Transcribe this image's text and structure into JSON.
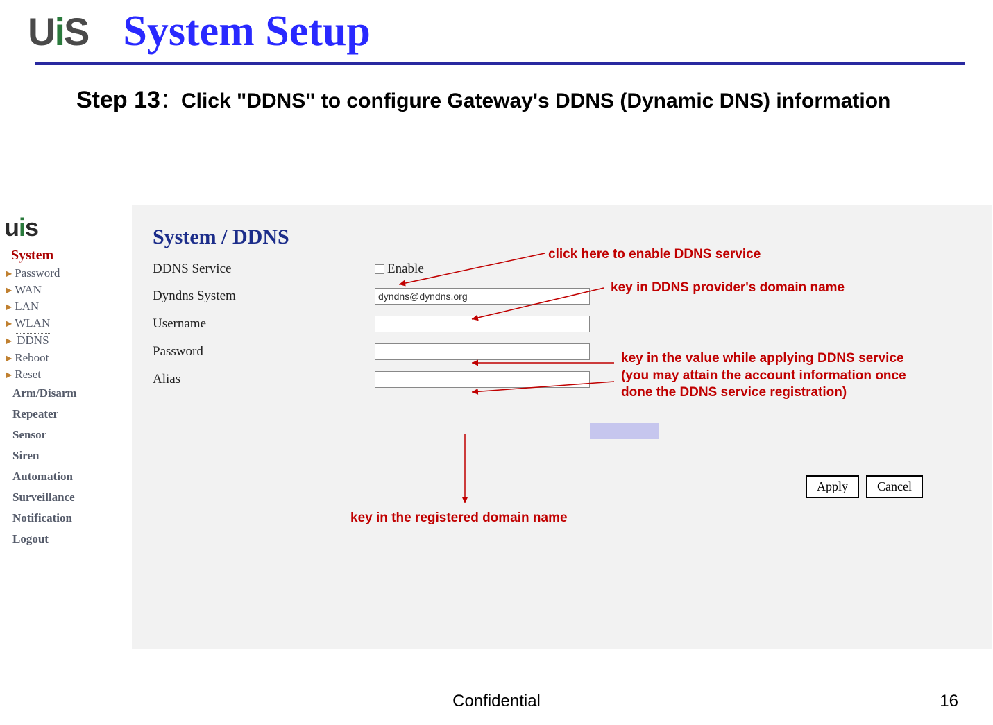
{
  "header": {
    "logo_text": "UiS",
    "title": "System Setup"
  },
  "step": {
    "label": "Step 13",
    "colon": "：",
    "desc": "Click \"DDNS\" to configure Gateway's DDNS (Dynamic DNS) information"
  },
  "inner": {
    "logo": "uis",
    "nav_heading": "System",
    "nav_items": [
      "Password",
      "WAN",
      "LAN",
      "WLAN",
      "DDNS",
      "Reboot",
      "Reset"
    ],
    "nav_groups": [
      "Arm/Disarm",
      "Repeater",
      "Sensor",
      "Siren",
      "Automation",
      "Surveillance",
      "Notification",
      "Logout"
    ]
  },
  "panel": {
    "title": "System / DDNS",
    "rows": {
      "ddns_service": "DDNS Service",
      "enable": "Enable",
      "dyndns_system": "Dyndns System",
      "dyndns_value": "dyndns@dyndns.org",
      "username": "Username",
      "password": "Password",
      "alias": "Alias"
    },
    "buttons": {
      "apply": "Apply",
      "cancel": "Cancel"
    }
  },
  "annotations": {
    "a1": "click here to enable DDNS service",
    "a2": "key in DDNS provider's domain name",
    "a3": "key in the value while applying DDNS service (you may attain the account information once done the DDNS service registration)",
    "a4": "key in the registered domain name"
  },
  "footer": {
    "center": "Confidential",
    "page": "16"
  }
}
